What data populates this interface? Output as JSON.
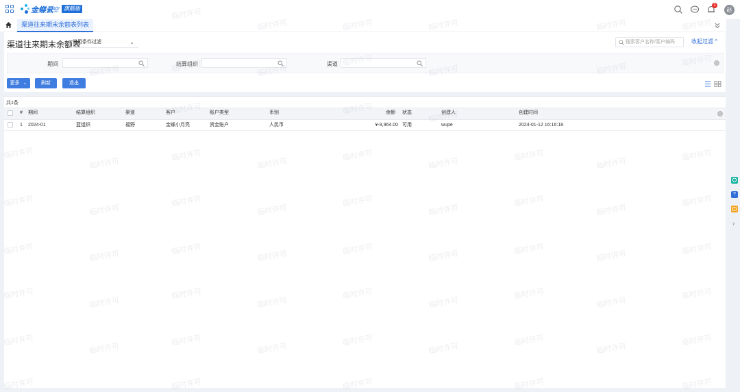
{
  "header": {
    "brand_name": "金蝶云",
    "brand_sub": "星空",
    "edition": "旗舰版",
    "notification_count": "1",
    "avatar_text": "赵"
  },
  "tabs": [
    {
      "label": "渠道往来期末余额表列表",
      "active": true
    }
  ],
  "panel": {
    "title": "渠道往来期末余额表",
    "scheme": "常用条件过滤",
    "search_placeholder": "搜索客户名称/客户编码",
    "collapse_label": "收起过滤 ^"
  },
  "filters": [
    {
      "label": "期间",
      "value": ""
    },
    {
      "label": "结算组织",
      "value": ""
    },
    {
      "label": "渠道",
      "value": ""
    }
  ],
  "toolbar": {
    "more_label": "更多",
    "refresh_label": "刷新",
    "exit_label": "退出"
  },
  "grid": {
    "count_label": "共1条",
    "columns": [
      "#",
      "期间",
      "结算组织",
      "渠道",
      "客户",
      "账户类型",
      "币别",
      "余额",
      "状态",
      "创建人",
      "创建时间"
    ],
    "rows": [
      [
        "1",
        "2024-01",
        "蓝组织",
        "福野",
        "金蝶小月亮",
        "资金账户",
        "人民币",
        "¥-9,964.00",
        "可用",
        "wupe",
        "2024-01-12 16:16:18"
      ]
    ]
  },
  "watermark_text": "临时许可",
  "colors": {
    "accent": "#2f6fd8",
    "button": "#3f7de0",
    "notification": "#e5312f"
  },
  "rightbar": [
    "green-chat-icon",
    "help-icon",
    "orange-app-icon",
    "chevron-right-icon"
  ]
}
